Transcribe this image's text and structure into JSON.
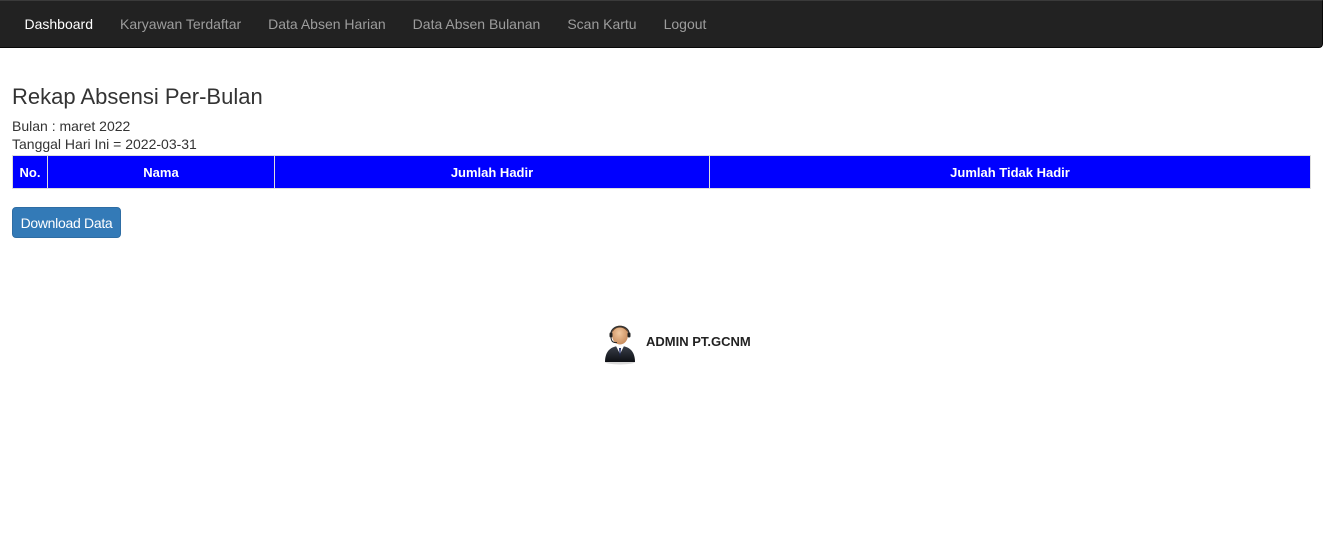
{
  "navbar": {
    "items": [
      {
        "label": "Dashboard",
        "active": true
      },
      {
        "label": "Karyawan Terdaftar",
        "active": false
      },
      {
        "label": "Data Absen Harian",
        "active": false
      },
      {
        "label": "Data Absen Bulanan",
        "active": false
      },
      {
        "label": "Scan Kartu",
        "active": false
      },
      {
        "label": "Logout",
        "active": false
      }
    ]
  },
  "main": {
    "title": "Rekap Absensi Per-Bulan",
    "month_line": "Bulan : maret 2022",
    "date_line": "Tanggal Hari Ini = 2022-03-31",
    "table": {
      "headers": [
        "No.",
        "Nama",
        "Jumlah Hadir",
        "Jumlah Tidak Hadir"
      ],
      "rows": []
    },
    "download_label": "Download Data"
  },
  "footer": {
    "admin_name": "ADMIN PT.GCNM",
    "avatar_icon": "user-headset-icon"
  },
  "colors": {
    "navbar_bg": "#222222",
    "table_header_bg": "#0000ff",
    "button_bg": "#337ab7"
  }
}
